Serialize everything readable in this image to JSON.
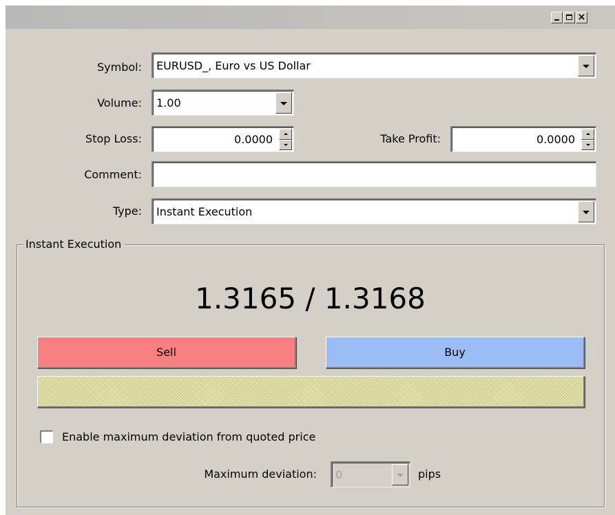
{
  "window": {
    "close_glyph": "×"
  },
  "form": {
    "symbol_label": "Symbol:",
    "symbol_value": "EURUSD_, Euro vs US Dollar",
    "volume_label": "Volume:",
    "volume_value": "1.00",
    "stoploss_label": "Stop Loss:",
    "stoploss_value": "0.0000",
    "takeprofit_label": "Take Profit:",
    "takeprofit_value": "0.0000",
    "comment_label": "Comment:",
    "comment_value": "",
    "type_label": "Type:",
    "type_value": "Instant Execution"
  },
  "execution": {
    "group_title": "Instant Execution",
    "price": "1.3165 / 1.3168",
    "sell_label": "Sell",
    "buy_label": "Buy",
    "sell_color": "#f88080",
    "buy_color": "#9bbcf4",
    "status_color": "#e8e6b0",
    "max_deviation_checkbox_label": "Enable maximum deviation from quoted price",
    "max_deviation_checked": false,
    "max_deviation_label": "Maximum deviation:",
    "max_deviation_value": "0",
    "pips_label": "pips"
  },
  "icons": {
    "minimize": "minimize-icon",
    "maximize": "maximize-icon",
    "close": "close-icon",
    "dropdown": "chevron-down-icon",
    "spinner_up": "spin-up-icon",
    "spinner_down": "spin-down-icon"
  }
}
